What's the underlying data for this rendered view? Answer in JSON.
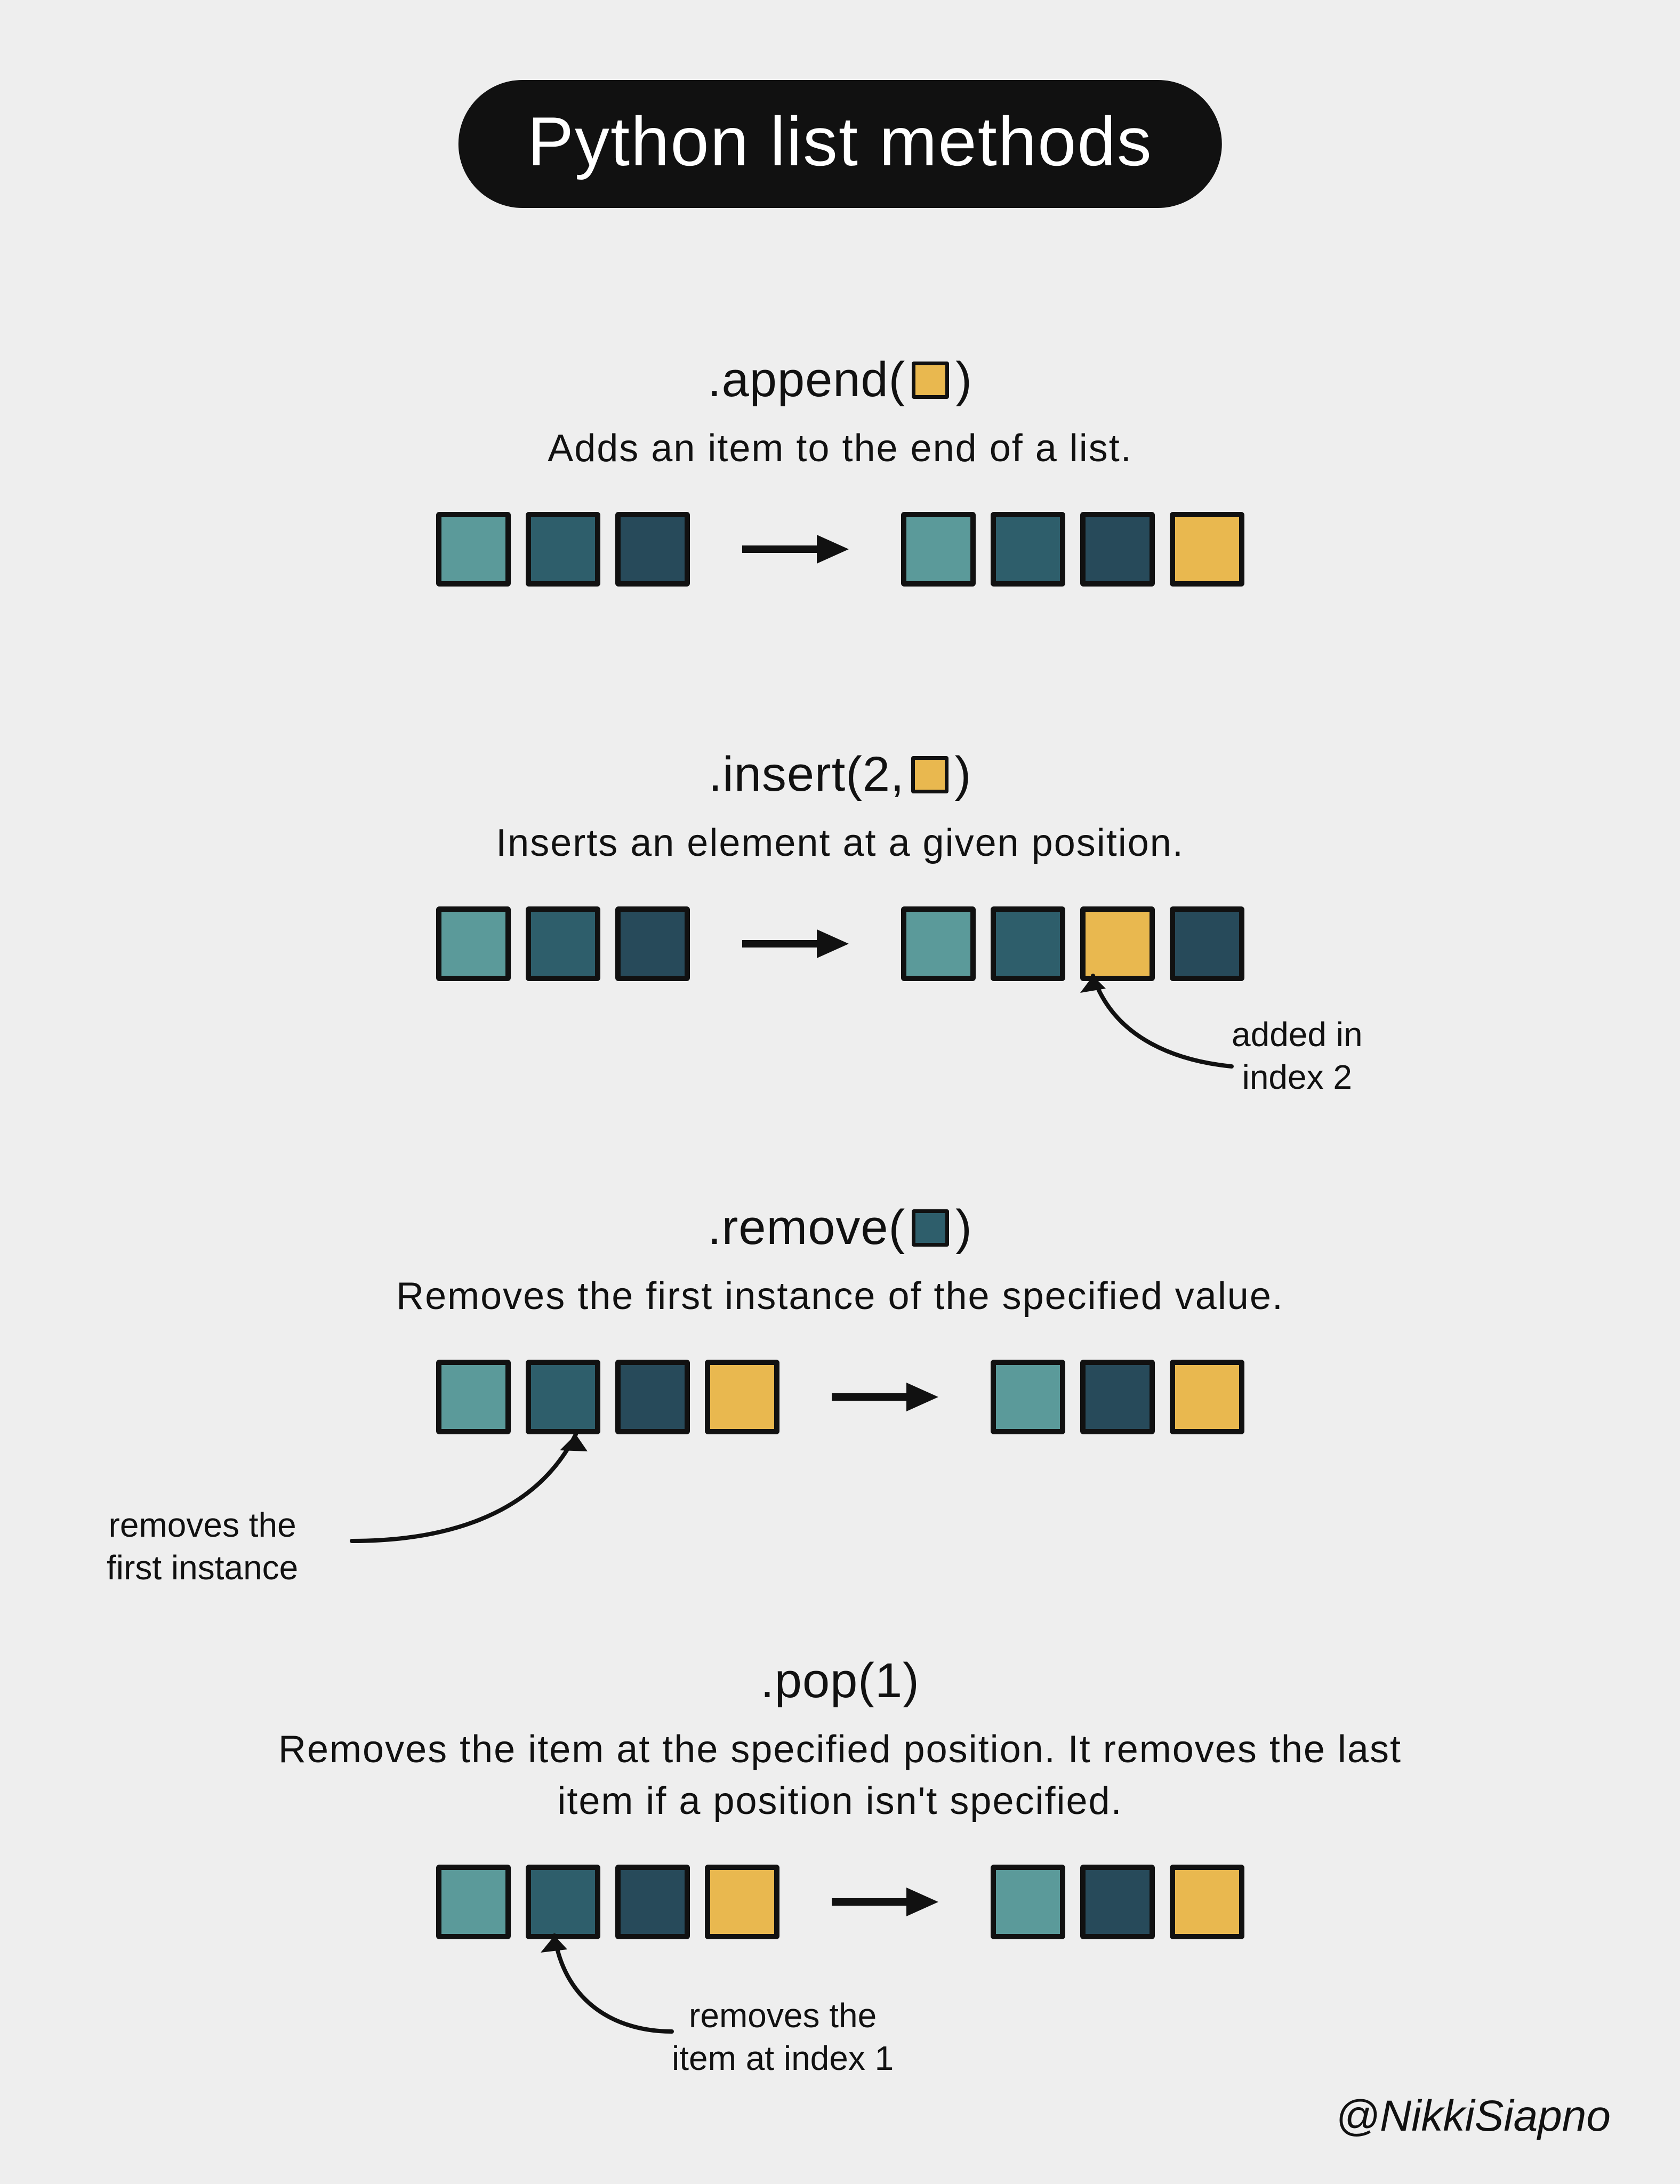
{
  "title": "Python list methods",
  "credit": "@NikkiSiapno",
  "colors": {
    "teal": "#5b9a9a",
    "dteal": "#2e5e6b",
    "navy": "#274a5a",
    "gold": "#e9b84f",
    "ink": "#111111",
    "bg": "#eeeeee"
  },
  "methods": [
    {
      "id": "append",
      "sig_prefix": ".append(",
      "sig_arg_color": "gold",
      "sig_suffix": ")",
      "desc": "Adds an item to the end of a list.",
      "before": [
        "teal",
        "dteal",
        "navy"
      ],
      "after": [
        "teal",
        "dteal",
        "navy",
        "gold"
      ],
      "annotation": null
    },
    {
      "id": "insert",
      "sig_prefix": ".insert(2, ",
      "sig_arg_color": "gold",
      "sig_suffix": ")",
      "desc": "Inserts an element at a given position.",
      "before": [
        "teal",
        "dteal",
        "navy"
      ],
      "after": [
        "teal",
        "dteal",
        "gold",
        "navy"
      ],
      "annotation": {
        "text_l1": "added in",
        "text_l2": "index 2"
      }
    },
    {
      "id": "remove",
      "sig_prefix": ".remove(",
      "sig_arg_color": "dteal",
      "sig_suffix": ")",
      "desc": "Removes the first instance of the specified value.",
      "before": [
        "teal",
        "dteal",
        "navy",
        "gold"
      ],
      "after": [
        "teal",
        "navy",
        "gold"
      ],
      "annotation": {
        "text_l1": "removes the",
        "text_l2": "first instance"
      }
    },
    {
      "id": "pop",
      "sig_prefix": ".pop(1)",
      "sig_arg_color": null,
      "sig_suffix": "",
      "desc": "Removes the item at the specified position. It removes the last item if a position isn't specified.",
      "before": [
        "teal",
        "dteal",
        "navy",
        "gold"
      ],
      "after": [
        "teal",
        "navy",
        "gold"
      ],
      "annotation": {
        "text_l1": "removes the",
        "text_l2": "item at index 1"
      }
    }
  ]
}
